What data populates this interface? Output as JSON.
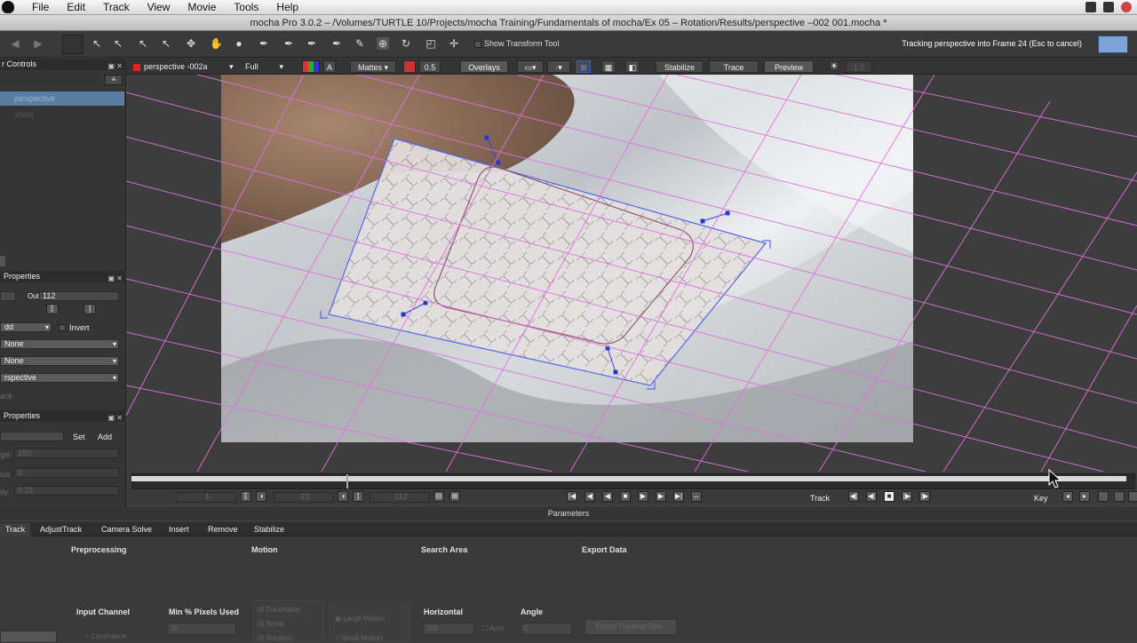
{
  "menubar": {
    "items": [
      "File",
      "Edit",
      "Track",
      "View",
      "Movie",
      "Tools",
      "Help"
    ]
  },
  "window": {
    "title": "mocha Pro 3.0.2 – /Volumes/TURTLE 10/Projects/mocha Training/Fundamentals of mocha/Ex 05 – Rotation/Results/perspective –002 001.mocha *"
  },
  "toolbar": {
    "show_transform_tool": "Show Transform Tool",
    "status": "Tracking perspective into Frame 24 (Esc to cancel)"
  },
  "viewerbar": {
    "layer": "perspective -002a",
    "resolution": "Full",
    "channel": "A",
    "mattes": "Mattes",
    "opacity": "0.5",
    "overlays": "Overlays",
    "stabilize": "Stabilize",
    "trace": "Trace",
    "preview": "Preview",
    "zoom_value": "1.0"
  },
  "leftpanel": {
    "layer_controls_title": "r Controls",
    "layers": [
      "perspective",
      "shear"
    ],
    "clip_properties_title": "Properties",
    "out_label": "Out",
    "out_value": "112",
    "blend_label": "dd",
    "invert_label": "Invert",
    "dropdown1": "None",
    "dropdown2": "None",
    "dropdown3": "rspective",
    "track_label": "ack",
    "edge_properties_title": "Properties",
    "set_label": "Set",
    "add_label": "Add",
    "angle_label": "gle",
    "angle_value": "180",
    "width_label": "ius",
    "width_value": "0",
    "opacity_label": "ity",
    "opacity_value": "0.25"
  },
  "transport": {
    "in_frame": "1",
    "current_frame": "23",
    "out_frame": "112",
    "track_label": "Track",
    "key_label": "Key"
  },
  "params": {
    "header": "Parameters",
    "tabs": [
      "Track",
      "AdjustTrack",
      "Camera Solve",
      "Insert",
      "Remove",
      "Stabilize"
    ],
    "sections": {
      "preprocessing": "Preprocessing",
      "motion": "Motion",
      "search_area": "Search Area",
      "export_data": "Export Data"
    },
    "input_channel_label": "Input Channel",
    "luminance": "Luminance",
    "min_pixels_label": "Min % Pixels Used",
    "min_pixels_value": "30",
    "translation": "Translation",
    "scale": "Scale",
    "rotation": "Rotation",
    "large_motion": "Large Motion",
    "small_motion": "Small Motion",
    "horizontal_label": "Horizontal",
    "horizontal_value": "100",
    "auto_label": "Auto",
    "angle_label": "Angle",
    "angle_value": "0",
    "export_button": "Export Tracking Data..."
  }
}
